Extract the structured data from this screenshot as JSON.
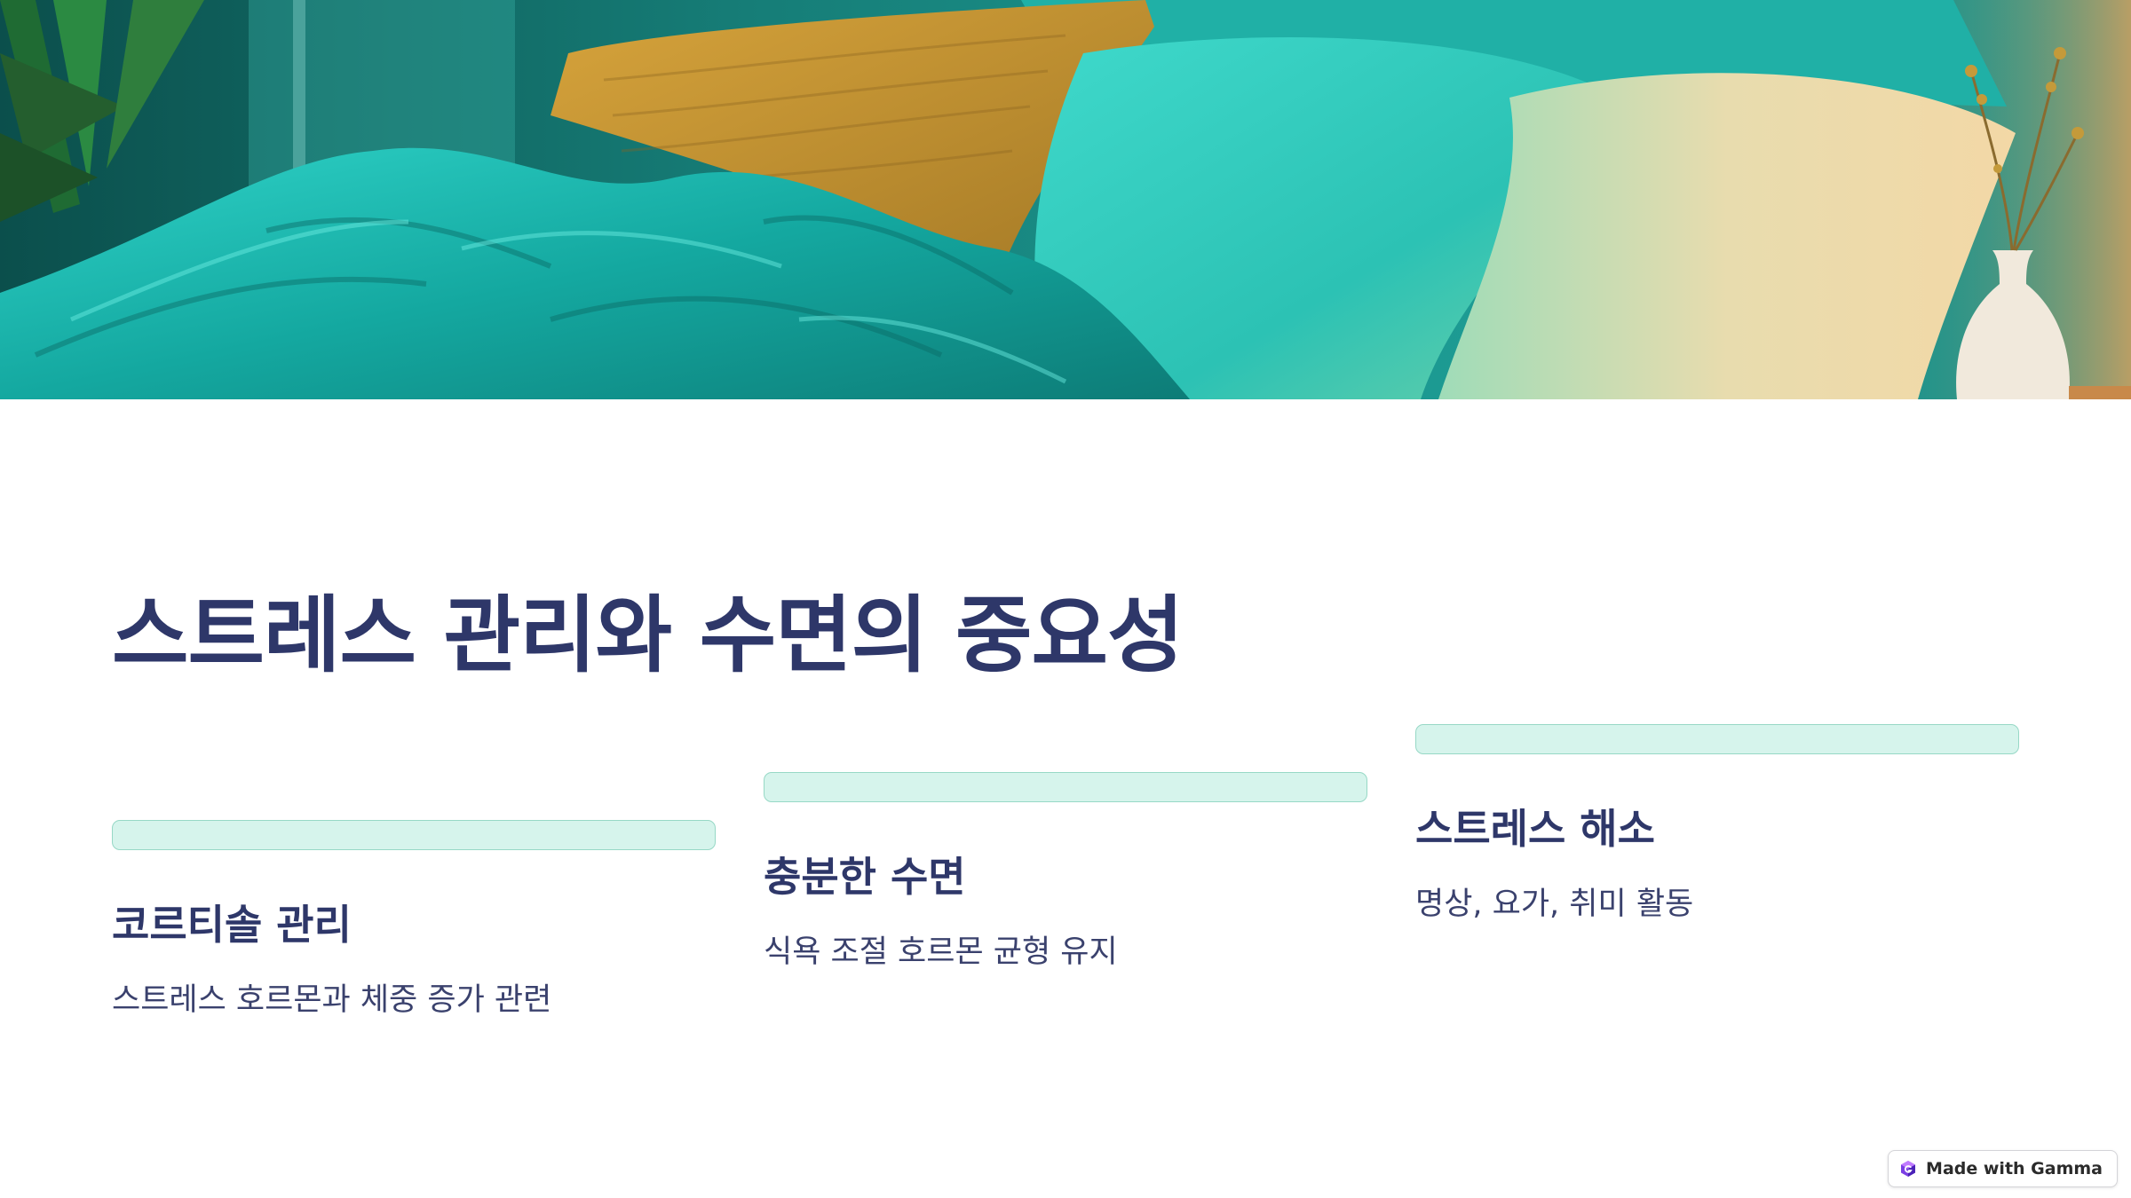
{
  "slide": {
    "title": "스트레스 관리와 수면의 중요성",
    "columns": [
      {
        "heading": "코르티솔 관리",
        "description": "스트레스 호르몬과 체중 증가 관련"
      },
      {
        "heading": "충분한 수면",
        "description": "식욕 조절 호르몬 균형 유지"
      },
      {
        "heading": "스트레스 해소",
        "description": "명상, 요가, 취미 활동"
      }
    ]
  },
  "badge": {
    "label": "Made with Gamma",
    "icon": "gamma-logo-icon"
  },
  "hero_image": {
    "icon": "bedroom-photo"
  },
  "colors": {
    "title": "#2e3769",
    "accent_bar": "#d6f4ec",
    "accent_border": "#97d8c6",
    "body_text": "#3a416d"
  }
}
